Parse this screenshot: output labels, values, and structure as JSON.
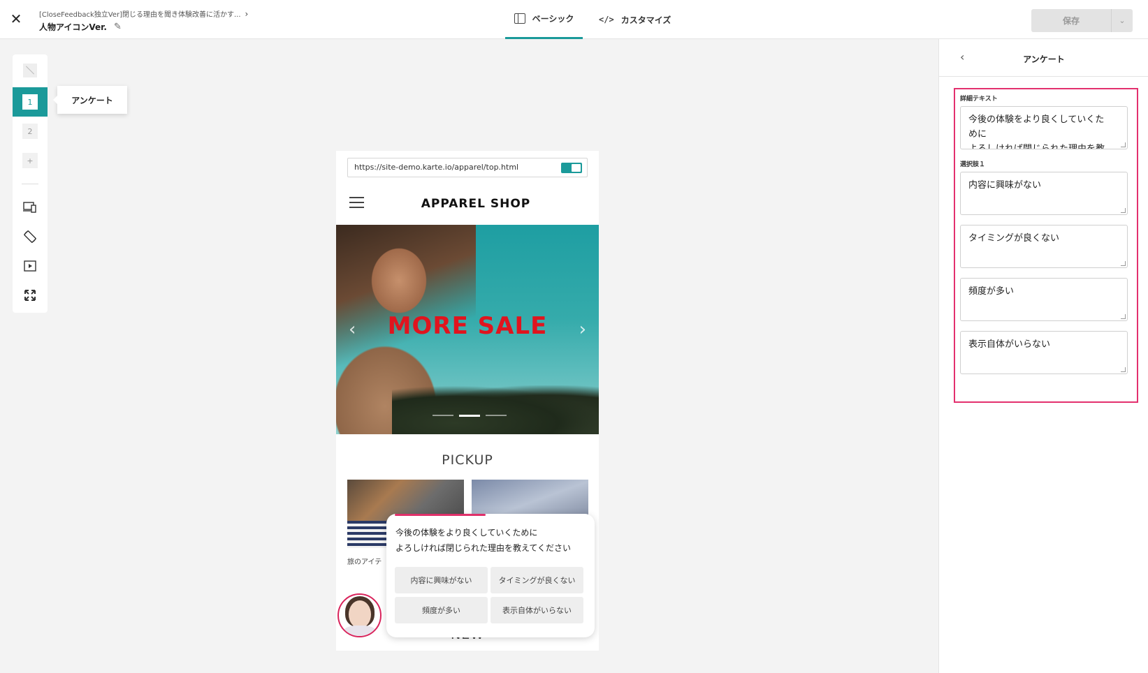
{
  "topbar": {
    "breadcrumb": "[CloseFeedback独立Ver]閉じる理由を聞き体験改善に活かす...",
    "title": "人物アイコンVer.",
    "tabs": [
      {
        "label": "ベーシック",
        "active": true
      },
      {
        "label": "カスタマイズ",
        "active": false
      }
    ],
    "save_label": "保存"
  },
  "rail": {
    "steps": [
      "1",
      "2"
    ],
    "add_label": "+",
    "tooltip": "アンケート"
  },
  "preview": {
    "url": "https://site-demo.karte.io/apparel/top.html",
    "shop_title": "APPAREL SHOP",
    "hero_text": "MORE SALE",
    "hero_prev": "‹",
    "hero_next": "›",
    "pickup_heading": "PICKUP",
    "thumb_caption": "旅のアイテ",
    "new_heading": "NEW",
    "popup": {
      "line1": "今後の体験をより良くしていくために",
      "line2": "よろしければ閉じられた理由を教えてください",
      "options": [
        "内容に興味がない",
        "タイミングが良くない",
        "頻度が多い",
        "表示自体がいらない"
      ]
    }
  },
  "panel": {
    "title": "アンケート",
    "detail_label": "詳細テキスト",
    "detail_text": "今後の体験をより良くしていくた\nめに\nよろしければ閉じられた理由を教",
    "choice_label": "選択肢１",
    "choices": [
      "内容に興味がない",
      "タイミングが良くない",
      "頻度が多い",
      "表示自体がいらない"
    ]
  },
  "colors": {
    "accent": "#1b9a9a",
    "highlight": "#e3306e",
    "sale_red": "#e0141e"
  }
}
